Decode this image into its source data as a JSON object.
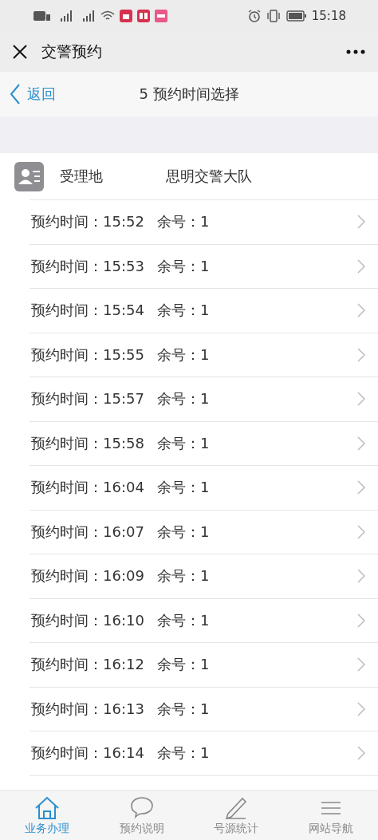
{
  "status_bar": {
    "time": "15:18"
  },
  "window": {
    "title": "交警预约"
  },
  "nav_bar": {
    "back": "返回",
    "title": "5 预约时间选择"
  },
  "office": {
    "label": "受理地",
    "value": "思明交警大队"
  },
  "slots": [
    {
      "time_label": "预约时间：15:52",
      "remaining": "余号：1"
    },
    {
      "time_label": "预约时间：15:53",
      "remaining": "余号：1"
    },
    {
      "time_label": "预约时间：15:54",
      "remaining": "余号：1"
    },
    {
      "time_label": "预约时间：15:55",
      "remaining": "余号：1"
    },
    {
      "time_label": "预约时间：15:57",
      "remaining": "余号：1"
    },
    {
      "time_label": "预约时间：15:58",
      "remaining": "余号：1"
    },
    {
      "time_label": "预约时间：16:04",
      "remaining": "余号：1"
    },
    {
      "time_label": "预约时间：16:07",
      "remaining": "余号：1"
    },
    {
      "time_label": "预约时间：16:09",
      "remaining": "余号：1"
    },
    {
      "time_label": "预约时间：16:10",
      "remaining": "余号：1"
    },
    {
      "time_label": "预约时间：16:12",
      "remaining": "余号：1"
    },
    {
      "time_label": "预约时间：16:13",
      "remaining": "余号：1"
    },
    {
      "time_label": "预约时间：16:14",
      "remaining": "余号：1"
    }
  ],
  "tab_bar": [
    {
      "kind": "home",
      "label": "业务办理",
      "selected": true
    },
    {
      "kind": "chat",
      "label": "预约说明",
      "selected": false
    },
    {
      "kind": "pencil",
      "label": "号源统计",
      "selected": false
    },
    {
      "kind": "menu",
      "label": "网站导航",
      "selected": false
    }
  ]
}
